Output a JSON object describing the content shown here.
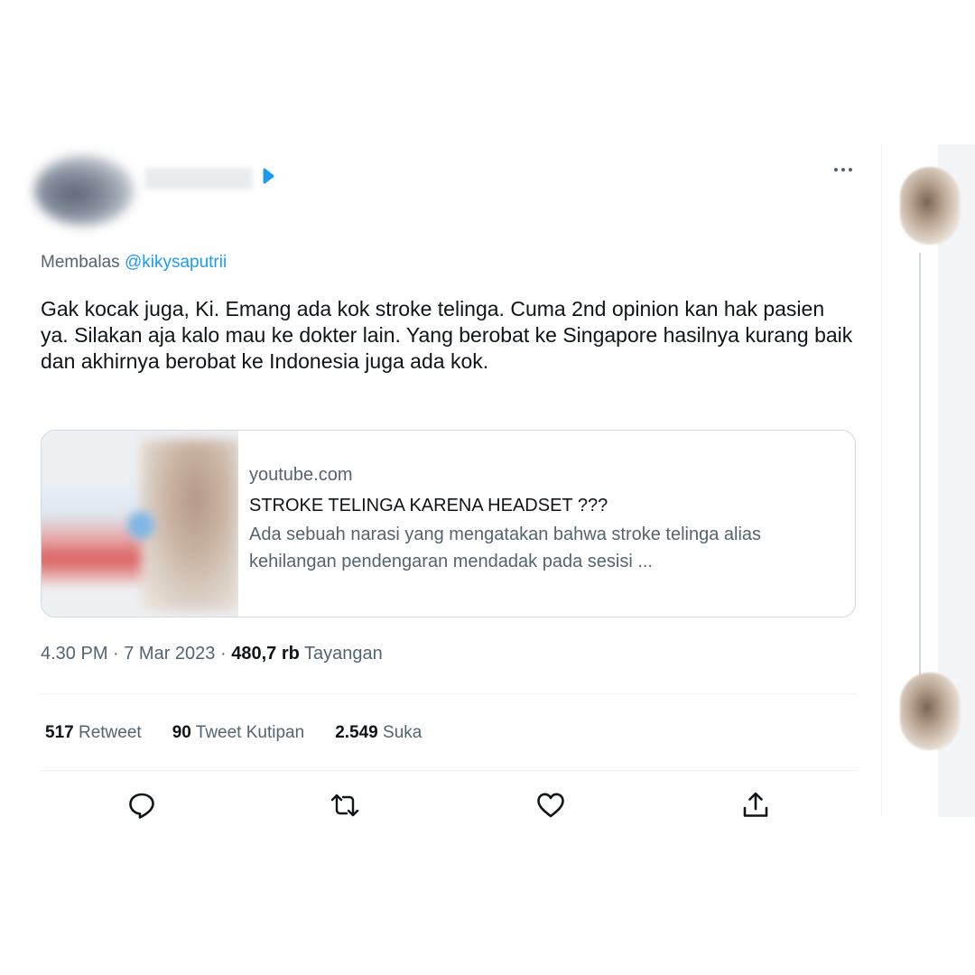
{
  "tweet": {
    "reply_prefix": "Membalas",
    "reply_handle": "@kikysaputrii",
    "text": "Gak kocak juga, Ki. Emang ada kok stroke telinga. Cuma 2nd opinion kan hak pasien ya. Silakan aja kalo mau ke dokter lain. Yang berobat ke Singapore hasilnya kurang baik dan akhirnya berobat ke Indonesia juga ada kok.",
    "card": {
      "domain": "youtube.com",
      "title": "STROKE TELINGA KARENA HEADSET ???",
      "description": "Ada sebuah narasi yang mengatakan bahwa stroke telinga alias kehilangan pendengaran mendadak pada sesisi ..."
    },
    "meta": {
      "time_date": "4.30 PM · 7 Mar 2023 ·",
      "views_count": "480,7 rb",
      "views_label": "Tayangan"
    },
    "stats": {
      "retweet_count": "517",
      "retweet_label": "Retweet",
      "quote_count": "90",
      "quote_label": "Tweet Kutipan",
      "like_count": "2.549",
      "like_label": "Suka"
    },
    "icons": {
      "verified": "verified-badge-icon",
      "more": "more-icon",
      "reply": "reply-icon",
      "retweet": "retweet-icon",
      "like": "like-icon",
      "share": "share-icon"
    }
  },
  "colors": {
    "accent": "#1d9bf0",
    "text_primary": "#0f1419",
    "text_secondary": "#536471",
    "border": "#cfd9de"
  }
}
